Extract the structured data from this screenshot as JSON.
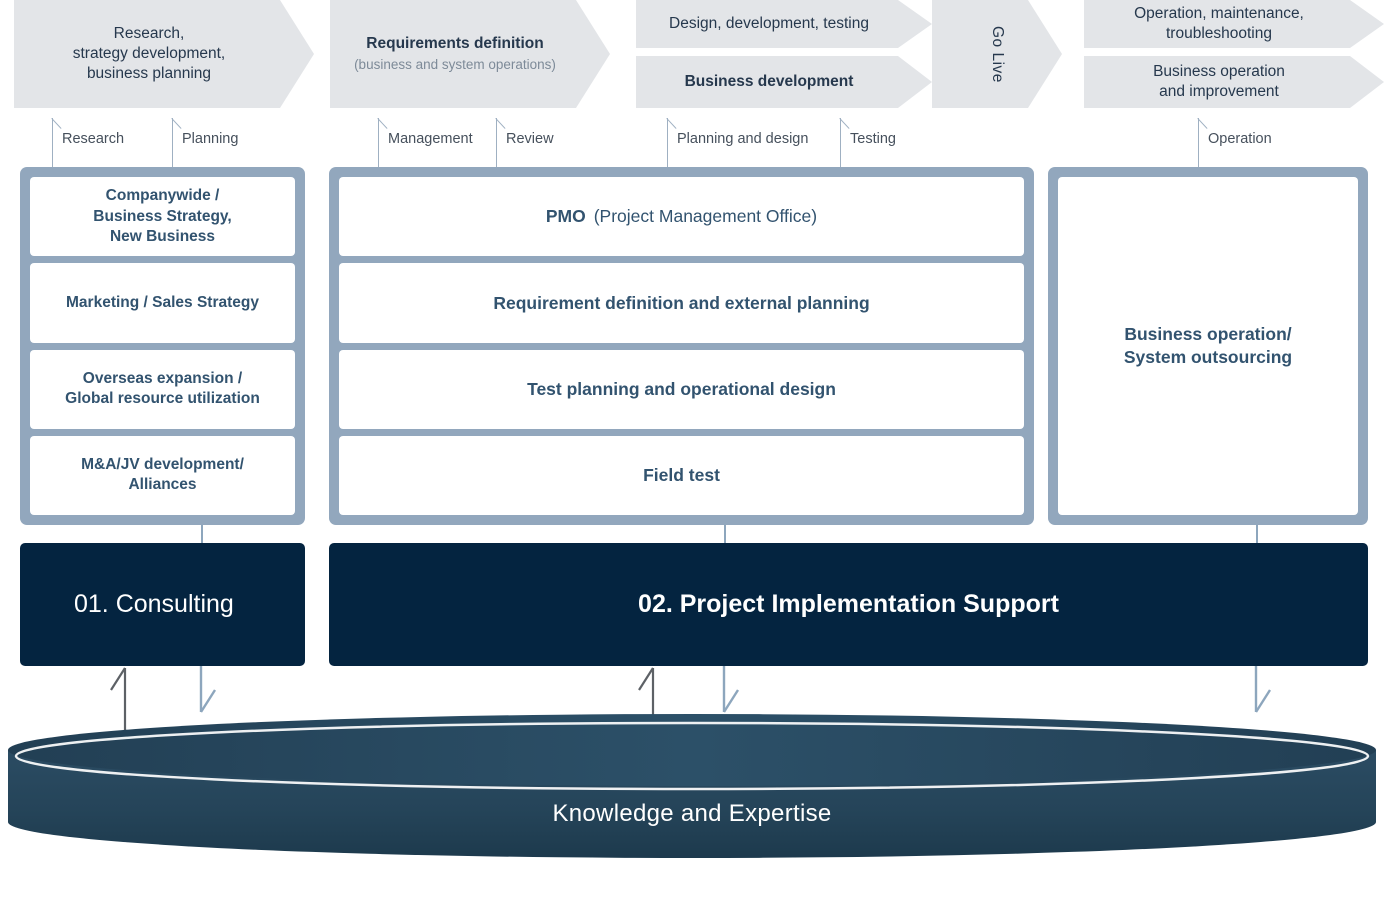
{
  "phases": [
    {
      "title": "Research,\nstrategy development,\nbusiness planning",
      "subtitle": "",
      "bold": false
    },
    {
      "title": "Requirements definition",
      "subtitle": "(business and system operations)",
      "bold": true
    },
    {
      "title": "Design, development, testing",
      "subtitle": "",
      "bold": false
    },
    {
      "title": "Business development",
      "subtitle": "",
      "bold": true
    },
    {
      "title": "Go Live",
      "subtitle": "",
      "bold": false
    },
    {
      "title": "Operation, maintenance,\ntroubleshooting",
      "subtitle": "",
      "bold": false
    },
    {
      "title": "Business operation\nand improvement",
      "subtitle": "",
      "bold": false
    }
  ],
  "ticks": [
    {
      "label": "Research"
    },
    {
      "label": "Planning"
    },
    {
      "label": "Management"
    },
    {
      "label": "Review"
    },
    {
      "label": "Planning and design"
    },
    {
      "label": "Testing"
    },
    {
      "label": "Operation"
    }
  ],
  "panels": {
    "consulting_cards": [
      "Companywide /\nBusiness Strategy,\nNew Business",
      "Marketing / Sales Strategy",
      "Overseas expansion /\nGlobal resource utilization",
      "M&A/JV development/\nAlliances"
    ],
    "project_cards": [
      {
        "strong": "PMO",
        "rest": "(Project Management Office)"
      },
      {
        "strong": "Requirement definition and external planning",
        "rest": ""
      },
      {
        "strong": "Test planning and operational design",
        "rest": ""
      },
      {
        "strong": "Field test",
        "rest": ""
      }
    ],
    "operation_cards": [
      "Business operation/\nSystem outsourcing"
    ]
  },
  "bars": {
    "consulting": "01. Consulting",
    "project": "02. Project Implementation Support"
  },
  "foundation": {
    "label": "Knowledge and Expertise"
  },
  "colors": {
    "arrow_bg": "#e3e5e8",
    "arrow_text": "#26384d",
    "panel_bg": "#92a7bd",
    "card_text": "#32536f",
    "dark_bar": "#042440",
    "cylinder": "#254459",
    "connector": "#8da6bd",
    "tick": "#9fb0c2"
  }
}
